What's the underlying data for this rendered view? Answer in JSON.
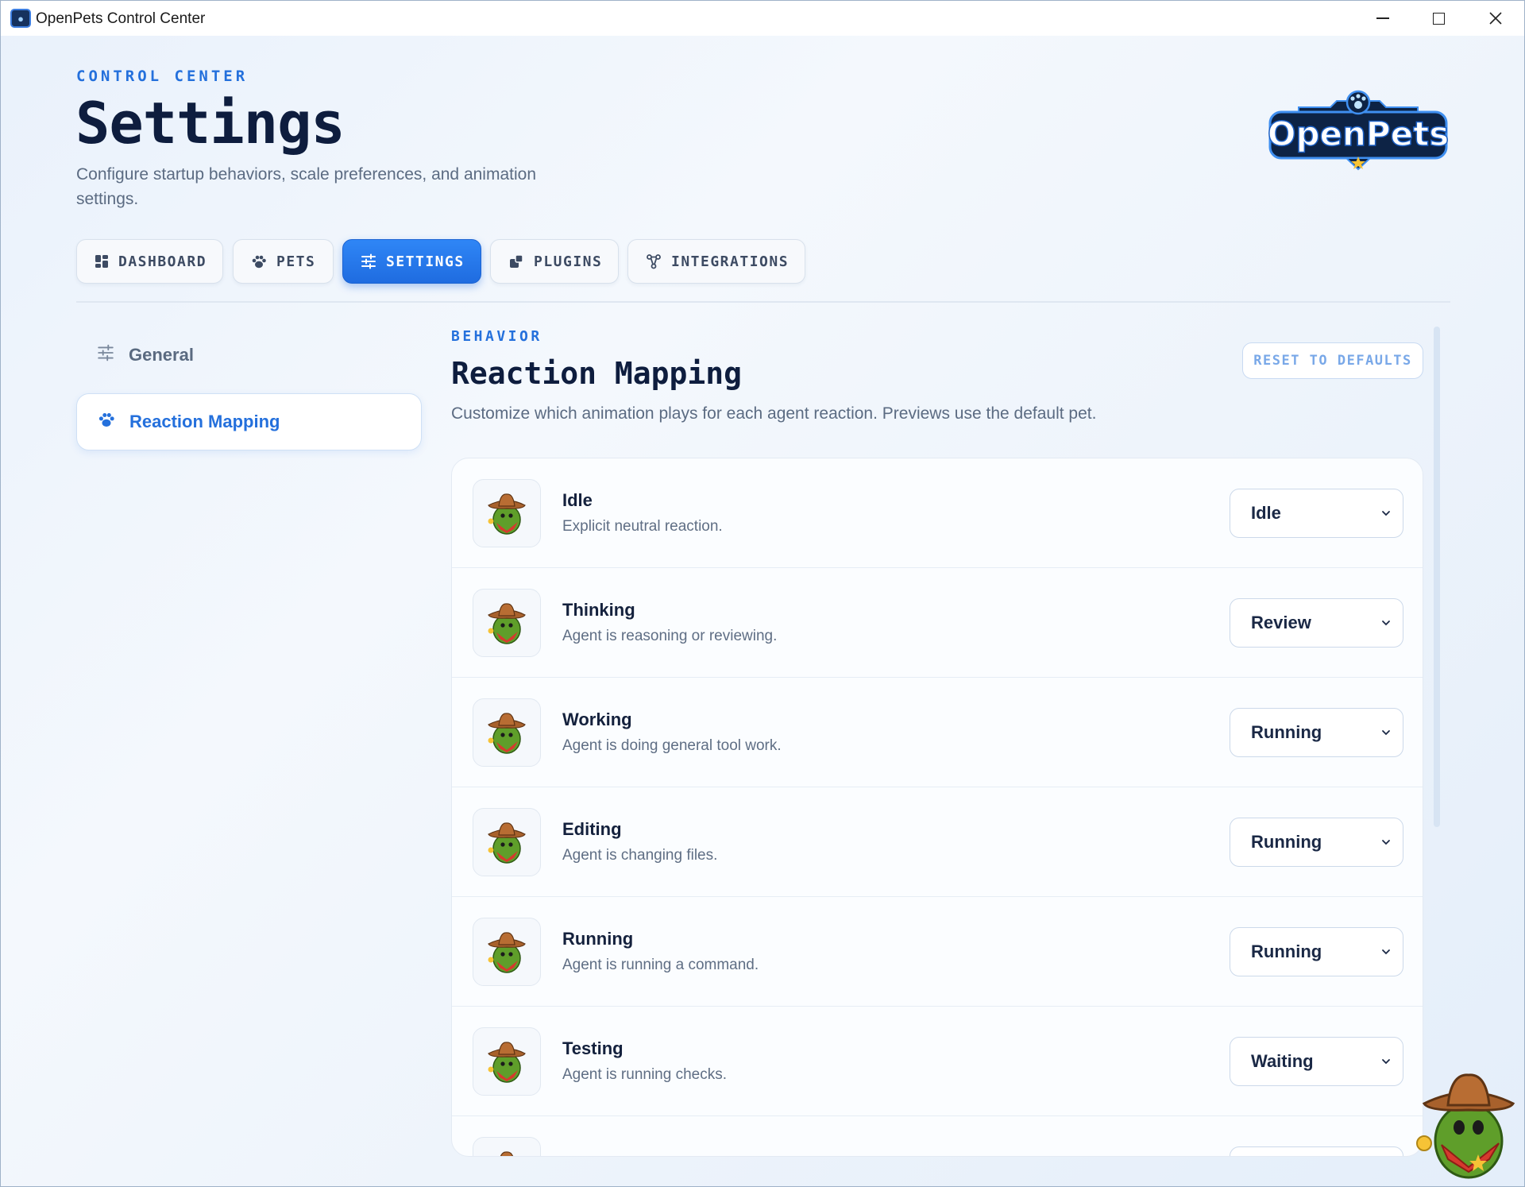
{
  "window": {
    "title": "OpenPets Control Center"
  },
  "header": {
    "eyebrow": "CONTROL CENTER",
    "title": "Settings",
    "subtitle": "Configure startup behaviors, scale preferences, and animation settings.",
    "logo_text": "OpenPets"
  },
  "tabs": [
    {
      "label": "DASHBOARD",
      "icon": "grid-icon",
      "active": false
    },
    {
      "label": "PETS",
      "icon": "paw-icon",
      "active": false
    },
    {
      "label": "SETTINGS",
      "icon": "sliders-icon",
      "active": true
    },
    {
      "label": "PLUGINS",
      "icon": "puzzle-icon",
      "active": false
    },
    {
      "label": "INTEGRATIONS",
      "icon": "nodes-icon",
      "active": false
    }
  ],
  "sidebar": {
    "items": [
      {
        "label": "General",
        "icon": "sliders-icon",
        "active": false
      },
      {
        "label": "Reaction Mapping",
        "icon": "paw-icon",
        "active": true
      }
    ]
  },
  "main": {
    "eyebrow": "BEHAVIOR",
    "title": "Reaction Mapping",
    "description": "Customize which animation plays for each agent reaction. Previews use the default pet.",
    "reset_label": "RESET TO DEFAULTS",
    "reactions": [
      {
        "name": "Idle",
        "desc": "Explicit neutral reaction.",
        "value": "Idle"
      },
      {
        "name": "Thinking",
        "desc": "Agent is reasoning or reviewing.",
        "value": "Review"
      },
      {
        "name": "Working",
        "desc": "Agent is doing general tool work.",
        "value": "Running"
      },
      {
        "name": "Editing",
        "desc": "Agent is changing files.",
        "value": "Running"
      },
      {
        "name": "Running",
        "desc": "Agent is running a command.",
        "value": "Running"
      },
      {
        "name": "Testing",
        "desc": "Agent is running checks.",
        "value": "Waiting"
      }
    ]
  },
  "colors": {
    "accent": "#2470dc",
    "title": "#0e1d3e",
    "muted": "#5b6b82"
  }
}
